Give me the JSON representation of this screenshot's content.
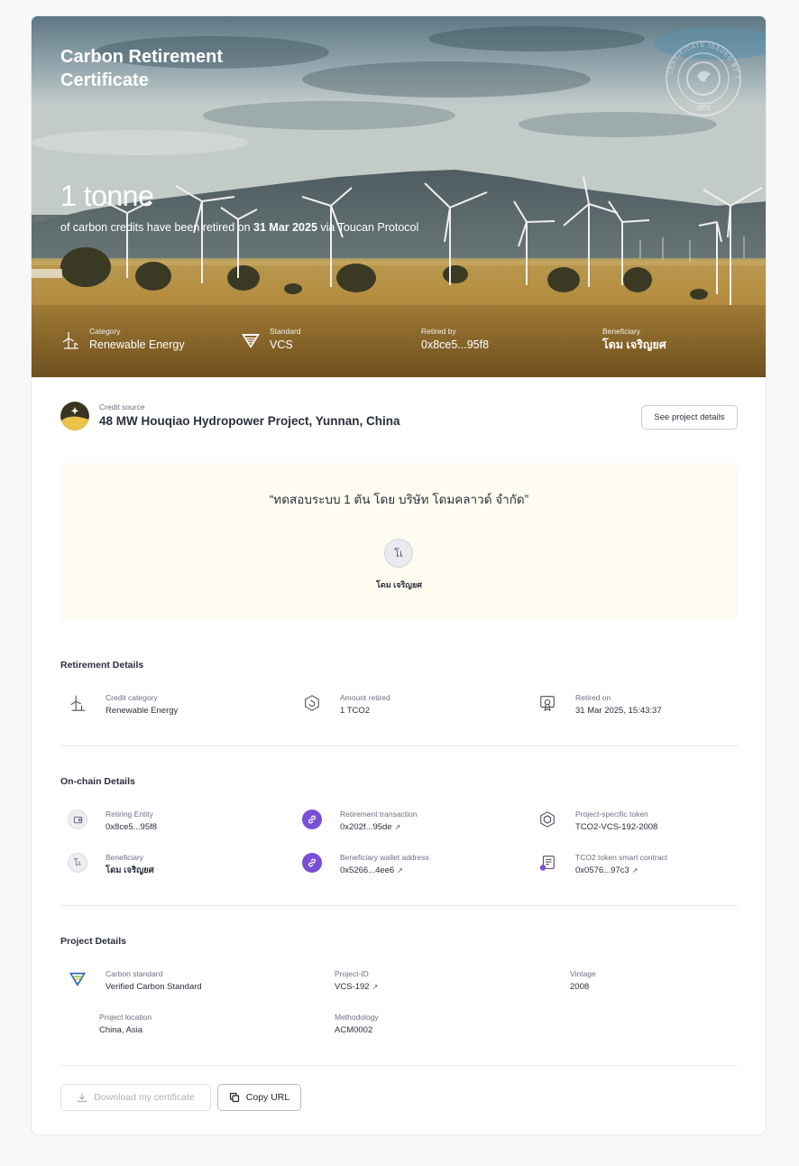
{
  "hero": {
    "title": "Carbon Retirement Certificate",
    "amount": "1 tonne",
    "sub_prefix": "of carbon credits have been retired on",
    "date": "31 Mar 2025",
    "sub_suffix": "via Toucan Protocol",
    "seal_text": "CERTIFICATE ISSUED BY TOUCAN",
    "seal_year": "2025",
    "meta": [
      {
        "label": "Category",
        "value": "Renewable Energy",
        "icon": "wind-turbine-icon"
      },
      {
        "label": "Standard",
        "value": "VCS",
        "icon": "vcs-logo-icon"
      },
      {
        "label": "Retired by",
        "value": "0x8ce5...95f8"
      },
      {
        "label": "Beneficiary",
        "value": "โดม เจริญยศ"
      }
    ]
  },
  "credit_source": {
    "label": "Credit source",
    "name": "48 MW Houqiao Hydropower Project, Yunnan, China",
    "button": "See project details"
  },
  "quote": {
    "text": "“ทดสอบระบบ 1 ตัน โดย บริษัท โดมคลาวด์ จำกัด”",
    "avatar_initial": "โเ",
    "name": "โดม เจริญยศ"
  },
  "retirement": {
    "title": "Retirement Details",
    "items": [
      {
        "label": "Credit category",
        "value": "Renewable Energy"
      },
      {
        "label": "Amount retired",
        "value": "1 TCO2"
      },
      {
        "label": "Retired on",
        "value": "31 Mar 2025, 15:43:37"
      }
    ]
  },
  "onchain": {
    "title": "On-chain Details",
    "items": [
      {
        "label": "Retiring Entity",
        "value": "0x8ce5...95f8"
      },
      {
        "label": "Retirement transaction",
        "value": "0x202f...95de"
      },
      {
        "label": "Project-specific token",
        "value": "TCO2-VCS-192-2008"
      },
      {
        "label": "Beneficiary",
        "value": "โดม เจริญยศ",
        "avatar": "โเ"
      },
      {
        "label": "Beneficiary wallet address",
        "value": "0x5266...4ee6"
      },
      {
        "label": "TCO2 token smart contract",
        "value": "0x0576...97c3"
      }
    ]
  },
  "project": {
    "title": "Project Details",
    "items": [
      {
        "label": "Carbon standard",
        "value": "Verified Carbon Standard"
      },
      {
        "label": "Project-ID",
        "value": "VCS-192"
      },
      {
        "label": "Vintage",
        "value": "2008"
      },
      {
        "label": "Project location",
        "value": "China, Asia"
      },
      {
        "label": "Methodology",
        "value": "ACM0002"
      }
    ]
  },
  "actions": {
    "download": "Download my certificate",
    "copy": "Copy URL"
  },
  "ext_arrow": "↗"
}
